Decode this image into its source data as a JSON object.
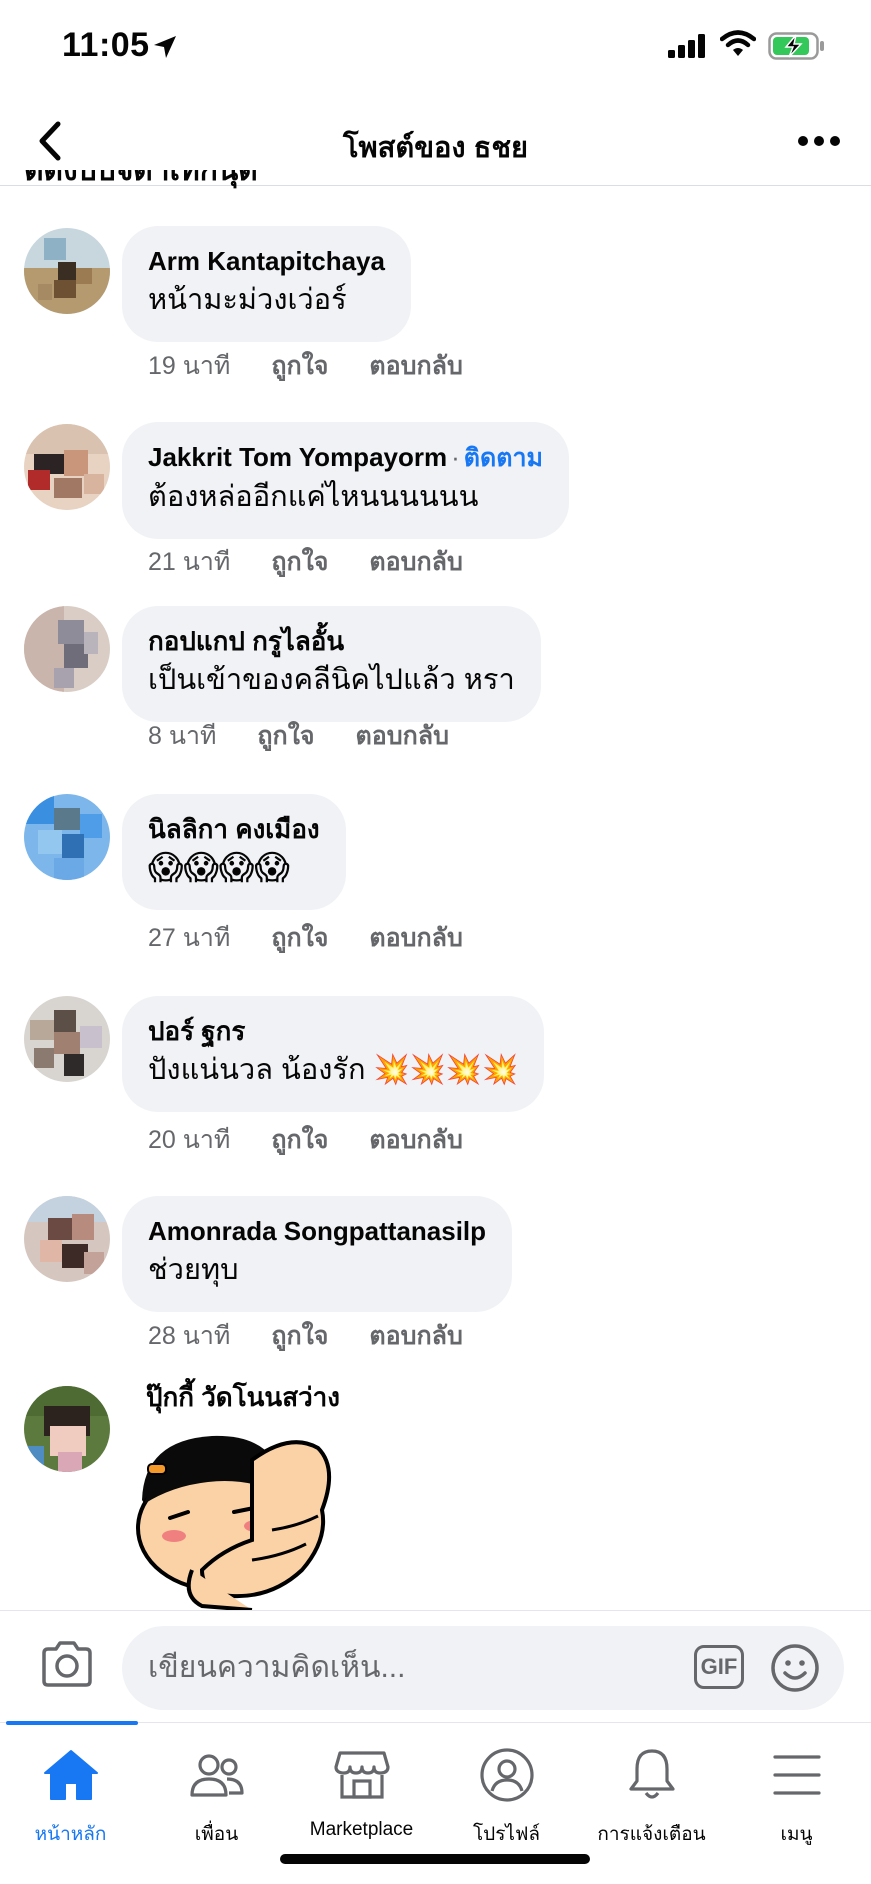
{
  "status_bar": {
    "time": "11:05"
  },
  "header": {
    "title": "โพสต์ของ ธชย"
  },
  "cut_text": "ตดงบบจดาเทกนุด",
  "comments": [
    {
      "author": "Arm Kantapitchaya",
      "text": "หน้ามะม่วงเว่อร์",
      "time": "19 นาที",
      "like": "ถูกใจ",
      "reply": "ตอบกลับ"
    },
    {
      "author": "Jakkrit Tom Yompayorm",
      "follow": "ติดตาม",
      "text": "ต้องหล่ออีกแค่ไหนนนนนน",
      "time": "21 นาที",
      "like": "ถูกใจ",
      "reply": "ตอบกลับ"
    },
    {
      "author": "กอปแกป กรูไลอั้น",
      "text": "เป็นเข้าของคลีนิคไปแล้ว หรา",
      "time": "8 นาที",
      "like": "ถูกใจ",
      "reply": "ตอบกลับ"
    },
    {
      "author": "นิลลิกา คงเมือง",
      "text": "😱😱😱😱",
      "time": "27 นาที",
      "like": "ถูกใจ",
      "reply": "ตอบกลับ"
    },
    {
      "author": "ปอร์ ฐกร",
      "text": "ปังแน่นวล  น้องรัก 💥💥💥💥",
      "time": "20 นาที",
      "like": "ถูกใจ",
      "reply": "ตอบกลับ"
    },
    {
      "author": "Amonrada Songpattanasilp",
      "text": "ช่วยทุบ",
      "time": "28 นาที",
      "like": "ถูกใจ",
      "reply": "ตอบกลับ"
    },
    {
      "author": "ปุ๊กกี้ วัดโนนสว่าง"
    }
  ],
  "composer": {
    "placeholder": "เขียนความคิดเห็น...",
    "gif_label": "GIF"
  },
  "tabs": [
    {
      "label": "หน้าหลัก",
      "icon": "home-icon",
      "active": true
    },
    {
      "label": "เพื่อน",
      "icon": "friends-icon"
    },
    {
      "label": "Marketplace",
      "icon": "marketplace-icon"
    },
    {
      "label": "โปรไฟล์",
      "icon": "profile-icon"
    },
    {
      "label": "การแจ้งเตือน",
      "icon": "bell-icon"
    },
    {
      "label": "เมนู",
      "icon": "menu-icon"
    }
  ],
  "colors": {
    "accent": "#1877f2",
    "bubble": "#f0f2f5",
    "muted": "#65676b"
  }
}
